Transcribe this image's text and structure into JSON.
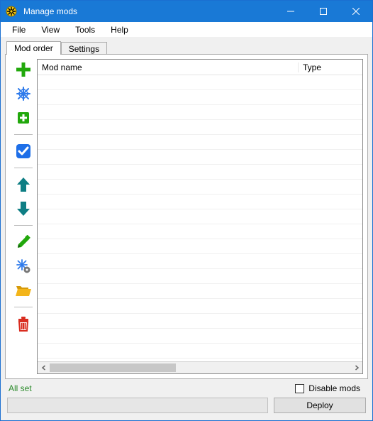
{
  "window": {
    "title": "Manage mods"
  },
  "menu": {
    "file": "File",
    "view": "View",
    "tools": "Tools",
    "help": "Help"
  },
  "tabs": {
    "mod_order": "Mod order",
    "settings": "Settings",
    "active": "mod_order"
  },
  "table": {
    "columns": {
      "name": "Mod name",
      "type": "Type"
    },
    "rows": []
  },
  "toolbar": {
    "add": "add-icon",
    "freeze": "snowflake-icon",
    "add_small": "add-small-icon",
    "toggle": "toggle-checked-icon",
    "move_up": "arrow-up-icon",
    "move_down": "arrow-down-icon",
    "edit": "pencil-icon",
    "freeze_edit": "snowflake-gear-icon",
    "open_folder": "folder-open-icon",
    "delete": "trash-icon"
  },
  "footer": {
    "status": "All set",
    "disable_mods_label": "Disable mods",
    "disable_mods_checked": false,
    "deploy_label": "Deploy"
  },
  "colors": {
    "accent": "#1979D6",
    "green": "#22A80C",
    "teal": "#0E7E84",
    "gold": "#F3B51A",
    "red": "#D92D20",
    "blue_icon": "#2F7BEB"
  }
}
